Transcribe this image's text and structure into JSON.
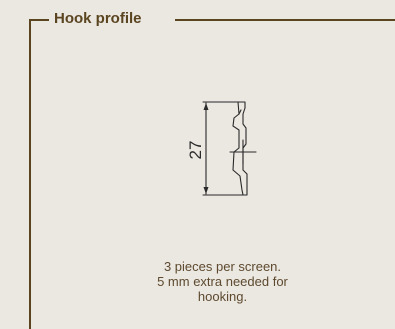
{
  "section": {
    "title": "Hook profile"
  },
  "drawing": {
    "dimension_label": "27",
    "icon": "hook-profile-cross-section"
  },
  "description": {
    "lines": [
      "3 pieces per screen.",
      "5 mm extra needed for",
      "hooking."
    ]
  },
  "colors": {
    "background": "#ebe7e1",
    "accent": "#5a4520",
    "text": "#5d4a2f"
  }
}
